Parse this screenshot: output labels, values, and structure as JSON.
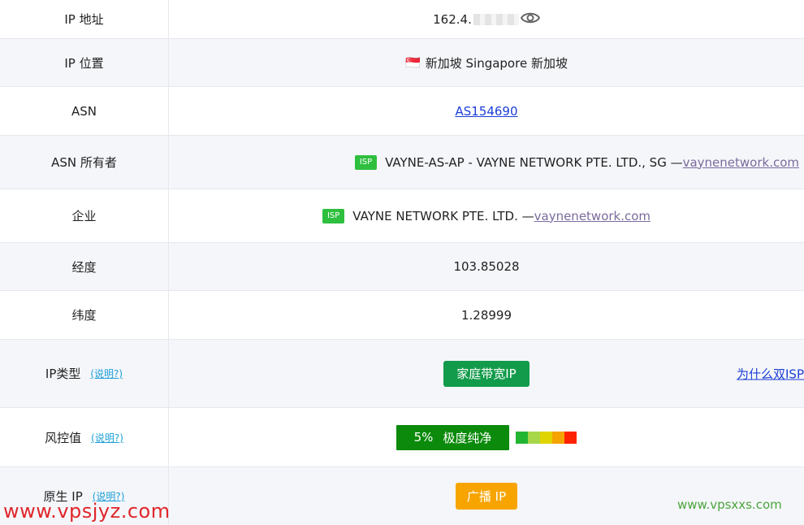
{
  "rows": {
    "ip_address": {
      "label": "IP 地址",
      "value": "162.4."
    },
    "ip_location": {
      "label": "IP 位置",
      "flag": "🇸🇬",
      "value": "新加坡 Singapore 新加坡"
    },
    "asn": {
      "label": "ASN",
      "value": "AS154690"
    },
    "asn_owner": {
      "label": "ASN 所有者",
      "badge": "ISP",
      "value": "VAYNE-AS-AP - VAYNE NETWORK PTE. LTD., SG —",
      "link": "vaynenetwork.com"
    },
    "company": {
      "label": "企业",
      "badge": "ISP",
      "value": "VAYNE NETWORK PTE. LTD. —",
      "link": "vaynenetwork.com"
    },
    "longitude": {
      "label": "经度",
      "value": "103.85028"
    },
    "latitude": {
      "label": "纬度",
      "value": "1.28999"
    },
    "ip_type": {
      "label": "IP类型",
      "help": "(说明?)",
      "value": "家庭带宽IP",
      "side_link": "为什么双ISP"
    },
    "risk": {
      "label": "风控值",
      "help": "(说明?)",
      "percent": "5%",
      "value": "极度纯净",
      "scale_colors": [
        "#22b532",
        "#a6d64a",
        "#e0d400",
        "#f5a300",
        "#ff2200"
      ]
    },
    "native_ip": {
      "label": "原生 IP",
      "help": "(说明?)",
      "value": "广播 IP"
    }
  },
  "watermarks": {
    "left": "www.vpsjyz.com",
    "right": "www.vpsxxs.com"
  }
}
